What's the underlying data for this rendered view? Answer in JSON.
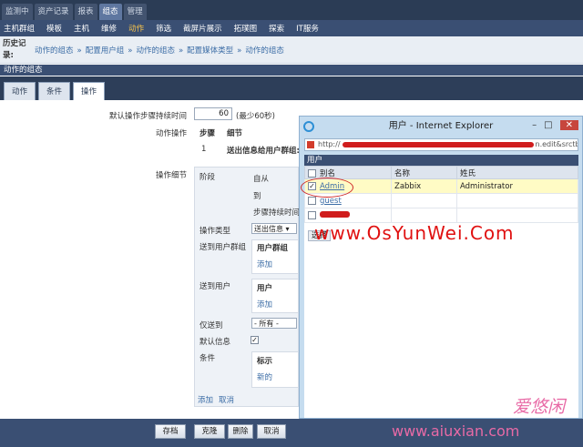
{
  "top_nav": [
    "监测中",
    "资产记录",
    "报表",
    "组态",
    "管理"
  ],
  "top_nav_active": 3,
  "sub_nav": [
    "主机群组",
    "模板",
    "主机",
    "维修",
    "动作",
    "筛选",
    "截屏片展示",
    "拓璞图",
    "探索",
    "IT服务"
  ],
  "sub_nav_active": 4,
  "history": {
    "label": "历史记录:",
    "crumbs": [
      "动作的组态",
      "»",
      "配置用户组",
      "»",
      "动作的组态",
      "»",
      "配置媒体类型",
      "»",
      "动作的组态"
    ]
  },
  "section_title": "动作的组态",
  "tabs": [
    "动作",
    "条件",
    "操作"
  ],
  "tabs_active": 2,
  "form": {
    "default_step_label": "默认操作步骤持续时间",
    "default_step_value": "60",
    "default_step_hint": "(最少60秒)",
    "actions_label": "动作操作",
    "ops_header_step": "步骤",
    "ops_header_detail": "细节",
    "ops_row_step": "1",
    "ops_row_detail": "送出信息给用户群组:",
    "op_detail_label": "操作细节",
    "step_label": "阶段",
    "from_label": "自从",
    "to_label": "到",
    "duration_label": "步骤持续时间",
    "op_type_label": "操作类型",
    "op_type_value": "送出信息",
    "send_group_label": "送到用户群组",
    "group_header": "用户群组",
    "add1": "添加",
    "send_user_label": "送到用户",
    "user_header": "用户",
    "add2": "添加",
    "only_send_label": "仅送到",
    "only_send_value": "- 所有 -",
    "default_msg_label": "默认信息",
    "condition_label": "条件",
    "cond_header": "标示",
    "new_link": "新的",
    "add_link": "添加",
    "cancel_link": "取消"
  },
  "buttons": {
    "save": "存档",
    "clone": "克隆",
    "delete": "删除",
    "cancel": "取消"
  },
  "popup": {
    "title": "用户 - Internet Explorer",
    "address_start": "http://",
    "address_end": "n.edit&srctbl=use",
    "header": "用户",
    "columns": [
      "别名",
      "名称",
      "姓氏"
    ],
    "rows": [
      {
        "alias": "Admin",
        "name": "Zabbix",
        "surname": "Administrator",
        "checked": true
      },
      {
        "alias": "guest",
        "name": "",
        "surname": "",
        "checked": false
      }
    ],
    "select_button": "选择"
  },
  "watermarks": {
    "osyunwei": "www.OsYunWei.Com",
    "aiuxian_cn": "爱悠闲",
    "aiuxian_url": "www.aiuxian.com"
  }
}
